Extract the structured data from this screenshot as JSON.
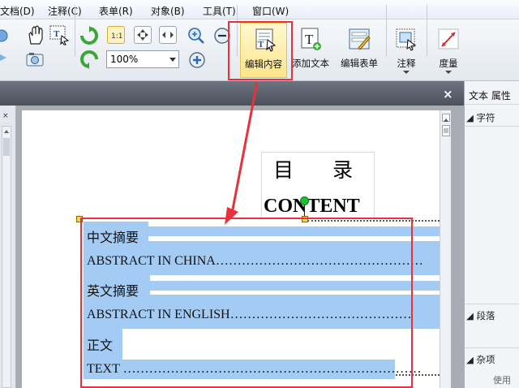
{
  "menubar": {
    "items": [
      "文档(D)",
      "注释(C)",
      "表单(R)",
      "对象(B)",
      "工具(T)",
      "窗口(W)"
    ]
  },
  "toolbar": {
    "zoom_value": "100%",
    "buttons": [
      {
        "label": "编辑内容",
        "active": true
      },
      {
        "label": "添加文本",
        "active": false
      },
      {
        "label": "编辑表单",
        "active": false
      },
      {
        "label": "注释",
        "active": false
      },
      {
        "label": "度量",
        "active": false
      }
    ]
  },
  "tab_close": "×",
  "left_panel_close": "×",
  "document": {
    "toc_title": "目录",
    "toc_subtitle": "CONTENT",
    "rows": [
      {
        "label": "中文摘要"
      },
      {
        "label": "ABSTRACT IN CHINA…………………………………………"
      },
      {
        "label": "英文摘要"
      },
      {
        "label": "ABSTRACT IN ENGLISH……………………………………"
      },
      {
        "label": "正文"
      },
      {
        "label": "TEXT ……………………………………………………………"
      }
    ]
  },
  "right_panel": {
    "title": "文本 属性",
    "sections": [
      "字符",
      "段落",
      "杂项"
    ],
    "misc_hint": "使用"
  },
  "colors": {
    "accent_red": "#e8313b",
    "selection_blue": "#a4cbf3",
    "active_button": "#fde68a"
  }
}
